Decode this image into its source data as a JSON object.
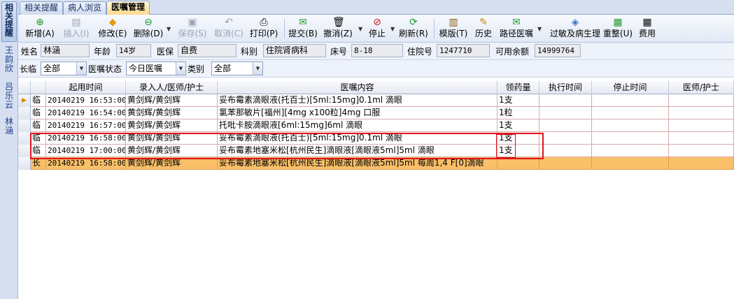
{
  "sidebar": {
    "tab": "相关提醒",
    "names": [
      "王韵欣",
      "吕乐云",
      "林涵"
    ]
  },
  "tabs": [
    "相关提醒",
    "病人浏览",
    "医嘱管理"
  ],
  "toolbar": {
    "buttons": [
      {
        "label": "新增(A)",
        "icon": "add-icon",
        "disabled": false
      },
      {
        "label": "插入(I)",
        "icon": "insert-icon",
        "disabled": true
      },
      {
        "label": "修改(E)",
        "icon": "edit-icon",
        "disabled": false
      },
      {
        "label": "删除(D)",
        "icon": "delete-icon",
        "disabled": false
      },
      {
        "label": "保存(S)",
        "icon": "save-icon",
        "disabled": true
      },
      {
        "label": "取消(C)",
        "icon": "undo-icon",
        "disabled": true
      },
      {
        "label": "打印(P)",
        "icon": "print-icon",
        "disabled": false
      },
      {
        "label": "提交(B)",
        "icon": "submit-icon",
        "disabled": false
      },
      {
        "label": "撤消(Z)",
        "icon": "trash-icon",
        "disabled": false
      },
      {
        "label": "停止",
        "icon": "stop-icon",
        "disabled": false
      },
      {
        "label": "刷新(R)",
        "icon": "refresh-icon",
        "disabled": false
      },
      {
        "label": "模版(T)",
        "icon": "template-icon",
        "disabled": false
      },
      {
        "label": "历史",
        "icon": "history-icon",
        "disabled": false
      },
      {
        "label": "路径医嘱",
        "icon": "path-icon",
        "disabled": false
      },
      {
        "label": "过敏及病生理",
        "icon": "allergy-icon",
        "disabled": false
      },
      {
        "label": "重整(U)",
        "icon": "reorganize-icon",
        "disabled": false
      },
      {
        "label": "费用",
        "icon": "calculator-icon",
        "disabled": false
      }
    ]
  },
  "patient": {
    "name_label": "姓名",
    "name": "林涵",
    "age_label": "年龄",
    "age": "14岁",
    "insurance_label": "医保",
    "insurance": "自费",
    "dept_label": "科别",
    "dept": "住院肾病科",
    "bed_label": "床号",
    "bed": "8-18",
    "inpatient_label": "住院号",
    "inpatient_no": "1247710",
    "balance_label": "可用余额",
    "balance": "14999764"
  },
  "filter": {
    "longtemp_label": "长临",
    "longtemp_value": "全部",
    "status_label": "医嘱状态",
    "status_value": "今日医嘱",
    "category_label": "类别",
    "category_value": "全部"
  },
  "grid": {
    "columns": [
      "起用时间",
      "录入人/医师/护士",
      "医嘱内容",
      "领药量",
      "执行时间",
      "停止时间",
      "医师/护士"
    ],
    "rows": [
      {
        "type": "临",
        "start": "20140219 16:53:00",
        "entered": "黄剑辉/黄剑辉",
        "content": "妥布霉素滴眼液(托百士)[5ml:15mg]0.1ml    滴眼",
        "qty": "1支",
        "exec": "",
        "stop": "",
        "doctor": "",
        "current": true
      },
      {
        "type": "临",
        "start": "20140219 16:54:00",
        "entered": "黄剑辉/黄剑辉",
        "content": "氯苯那敏片[福州][4mg x100粒]4mg    口服",
        "qty": "1粒",
        "exec": "",
        "stop": "",
        "doctor": ""
      },
      {
        "type": "临",
        "start": "20140219 16:57:00",
        "entered": "黄剑辉/黄剑辉",
        "content": "托吡卡胺滴眼液[6ml:15mg]6ml    滴眼",
        "qty": "1支",
        "exec": "",
        "stop": "",
        "doctor": ""
      },
      {
        "type": "临",
        "start": "20140219 16:58:00",
        "entered": "黄剑辉/黄剑辉",
        "content": "妥布霉素滴眼液(托百士)[5ml:15mg]0.1ml    滴眼",
        "qty": "1支",
        "exec": "",
        "stop": "",
        "doctor": ""
      },
      {
        "type": "临",
        "start": "20140219 17:00:00",
        "entered": "黄剑辉/黄剑辉",
        "content": "妥布霉素地塞米松[杭州民生]滴眼液[滴眼液5ml]5ml    滴眼",
        "qty": "1支",
        "exec": "",
        "stop": "",
        "doctor": ""
      },
      {
        "type": "长",
        "start": "20140219 16:58:00",
        "entered": "黄剑辉/黄剑辉",
        "content": "妥布霉素地塞米松[杭州民生]滴眼液[滴眼液5ml]5ml    每周1,4 F[0]滴眼",
        "qty": "",
        "exec": "",
        "stop": "",
        "doctor": "",
        "selected": true
      }
    ]
  },
  "colors": {
    "selected_row": "#f9bf69",
    "highlight_box": "#e0141c",
    "row_border": "#d8a8a8"
  }
}
